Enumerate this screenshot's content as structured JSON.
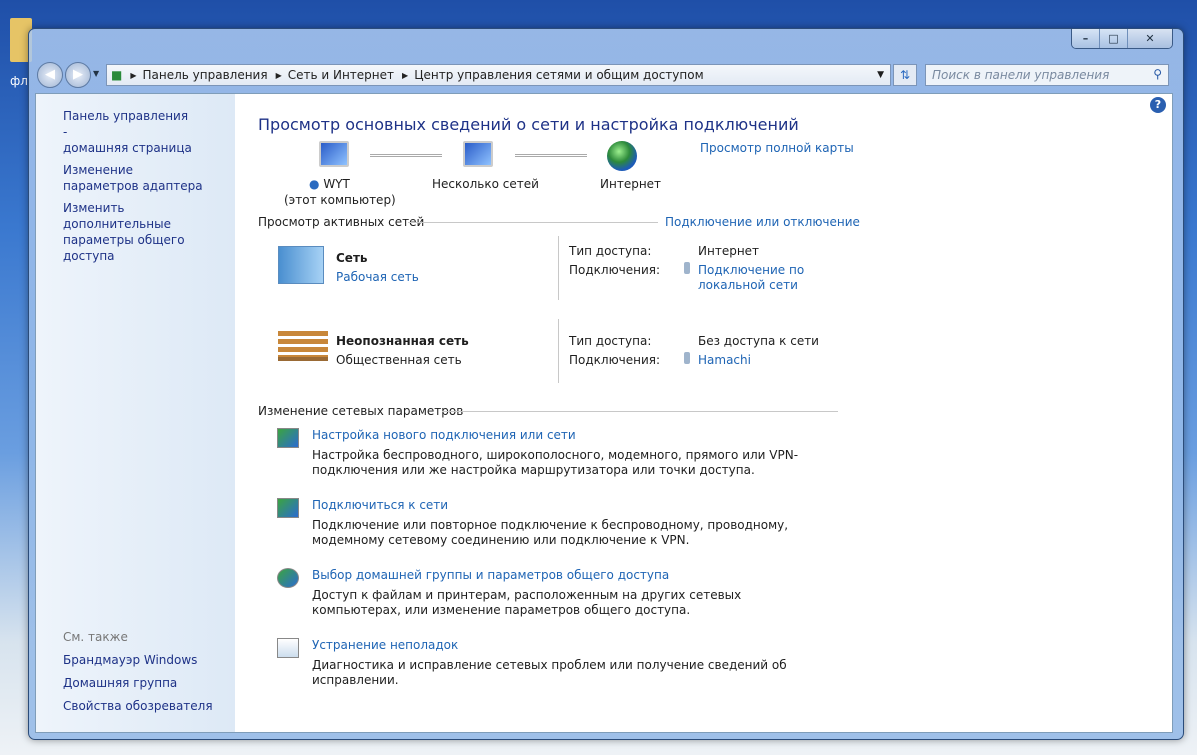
{
  "desktop": {
    "icon_label": "фл"
  },
  "address": {
    "crumbs": [
      "Панель управления",
      "Сеть и Интернет",
      "Центр управления сетями и общим доступом"
    ],
    "search_placeholder": "Поиск в панели управления"
  },
  "sidebar": {
    "links": [
      "Панель управления -\nдомашняя страница",
      "Изменение параметров адаптера",
      "Изменить дополнительные параметры общего доступа"
    ],
    "see_also": "См. также",
    "bottom_links": [
      "Брандмауэр Windows",
      "Домашняя группа",
      "Свойства обозревателя"
    ]
  },
  "main": {
    "title": "Просмотр основных сведений о сети и настройка подключений",
    "map": {
      "computer": "WYT",
      "computer_sub": "(этот компьютер)",
      "middle": "Несколько сетей",
      "internet": "Интернет",
      "full_map": "Просмотр полной карты"
    },
    "active_header": "Просмотр активных сетей",
    "connect_link": "Подключение или отключение",
    "networks": [
      {
        "name": "Сеть",
        "type": "Рабочая сеть",
        "type_is_link": true,
        "access_label": "Тип доступа:",
        "access": "Интернет",
        "conn_label": "Подключения:",
        "conn": "Подключение по локальной сети"
      },
      {
        "name": "Неопознанная сеть",
        "type": "Общественная сеть",
        "type_is_link": false,
        "access_label": "Тип доступа:",
        "access": "Без доступа к сети",
        "conn_label": "Подключения:",
        "conn": "Hamachi"
      }
    ],
    "change_header": "Изменение сетевых параметров",
    "tasks": [
      {
        "title": "Настройка нового подключения или сети",
        "desc": "Настройка беспроводного, широкополосного, модемного, прямого или VPN-подключения или же настройка маршрутизатора или точки доступа."
      },
      {
        "title": "Подключиться к сети",
        "desc": "Подключение или повторное подключение к беспроводному, проводному, модемному сетевому соединению или подключение к VPN."
      },
      {
        "title": "Выбор домашней группы и параметров общего доступа",
        "desc": "Доступ к файлам и принтерам, расположенным на других сетевых компьютерах, или изменение параметров общего доступа."
      },
      {
        "title": "Устранение неполадок",
        "desc": "Диагностика и исправление сетевых проблем или получение сведений об исправлении."
      }
    ]
  }
}
